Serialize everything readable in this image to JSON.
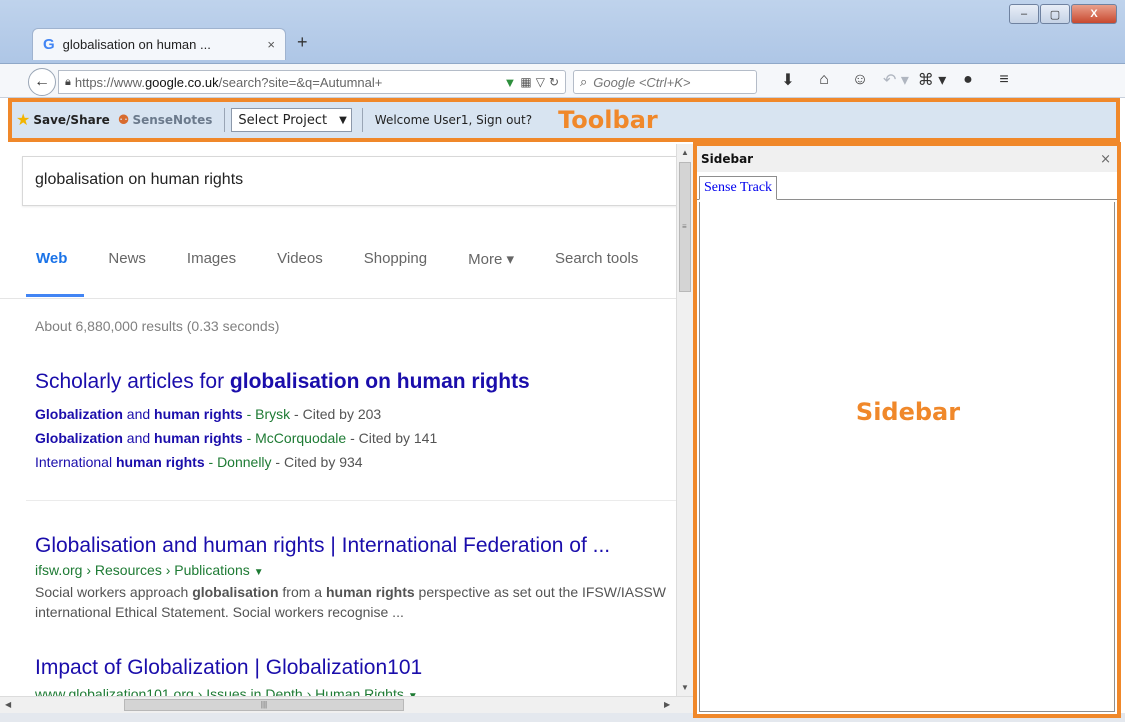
{
  "browser": {
    "tab_title": "globalisation on human ...",
    "tab_favicon": "G",
    "tab_close": "×",
    "new_tab": "+",
    "url_prefix": "https://www.",
    "url_domain": "google.co.uk",
    "url_rest": "/search?site=&q=Autumnal+",
    "search_placeholder": "Google <Ctrl+K>",
    "window_controls": {
      "minimize": "–",
      "maximize": "▢",
      "close": "X"
    }
  },
  "toolbar": {
    "save_share": "Save/Share",
    "sense_notes": "SenseNotes",
    "select_project": "Select Project",
    "welcome": "Welcome User1, Sign out?",
    "annotation": "Toolbar"
  },
  "google": {
    "query": "globalisation on human rights",
    "tabs": [
      "Web",
      "News",
      "Images",
      "Videos",
      "Shopping",
      "More ▾",
      "Search tools"
    ],
    "stats": "About 6,880,000 results (0.33 seconds)",
    "scholarly": {
      "title_prefix": "Scholarly articles for ",
      "title_bold": "globalisation on human rights",
      "lines": [
        {
          "link_a": "Globalization",
          "mid": " and ",
          "link_b": "human rights",
          "author": " - Brysk",
          "cited": " - Cited by 203"
        },
        {
          "link_a": "Globalization",
          "mid": " and ",
          "link_b": "human rights",
          "author": " - McCorquodale",
          "cited": " - Cited by 141"
        },
        {
          "link_a": "International ",
          "mid": "",
          "link_b": "human rights",
          "author": " - Donnelly",
          "cited": " - Cited by 934"
        }
      ]
    },
    "result1": {
      "title": "Globalisation and human rights | International Federation of ...",
      "url": "ifsw.org › Resources › Publications",
      "snippet_parts": [
        "Social workers approach ",
        "globalisation",
        " from a ",
        "human rights",
        " perspective as set out the IFSW/IASSW international Ethical Statement. Social workers recognise ..."
      ]
    },
    "result2": {
      "title": "Impact of Globalization | Globalization101",
      "url": "www.globalization101.org › Issues in Depth › Human Rights"
    }
  },
  "sidebar": {
    "header": "Sidebar",
    "close": "×",
    "tab": "Sense Track",
    "annotation": "Sidebar"
  },
  "colors": {
    "annotation": "#f0882a",
    "link": "#1a0dab",
    "url_green": "#1e7b34",
    "google_blue": "#4285f4"
  }
}
